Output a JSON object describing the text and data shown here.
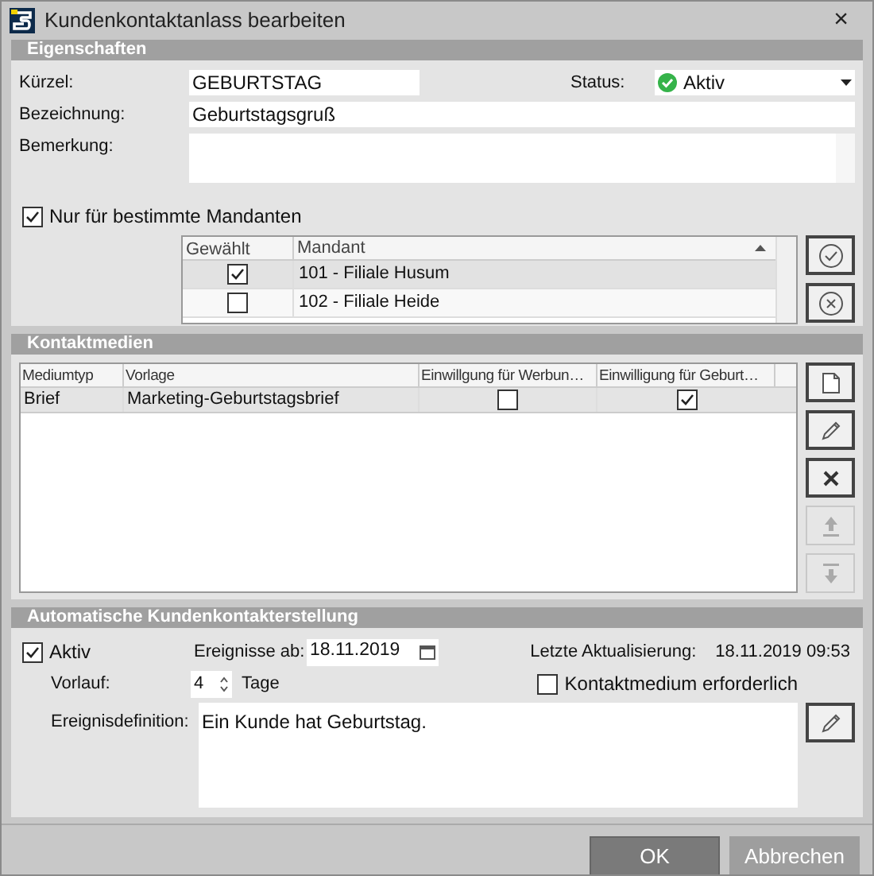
{
  "window": {
    "title": "Kundenkontaktanlass bearbeiten",
    "close": "×"
  },
  "eigenschaften": {
    "title": "Eigenschaften",
    "kuerzel": {
      "label": "Kürzel:",
      "value": "GEBURTSTAG"
    },
    "status": {
      "label": "Status:",
      "value": "Aktiv",
      "active": true
    },
    "bezeichnung": {
      "label": "Bezeichnung:",
      "value": "Geburtstagsgruß"
    },
    "bemerkung": {
      "label": "Bemerkung:"
    },
    "nur_mandanten": {
      "label": "Nur für bestimmte Mandanten",
      "checked": true
    },
    "mandanten_table": {
      "columns": [
        "Gewählt",
        "Mandant"
      ],
      "rows": [
        {
          "checked": true,
          "mandant": "101 - Filiale Husum",
          "selected": true
        },
        {
          "checked": false,
          "mandant": "102 - Filiale Heide",
          "selected": false
        }
      ]
    },
    "buttons": [
      {
        "kind": "check",
        "disabled": false
      },
      {
        "kind": "cancel",
        "disabled": false
      }
    ]
  },
  "kontaktmedien": {
    "title": "Kontaktmedien",
    "columns": [
      "Mediumtyp",
      "Vorlage",
      "Einwillgung für Werbun…",
      "Einwilligung für Geburt…"
    ],
    "rows": [
      {
        "mediumtyp": "Brief",
        "vorlage": "Marketing-Geburtstagsbrief",
        "werbung": false,
        "geburtstag": true,
        "selected": true
      }
    ],
    "buttons": [
      {
        "kind": "new",
        "disabled": false
      },
      {
        "kind": "edit",
        "disabled": false
      },
      {
        "kind": "delete",
        "disabled": false
      },
      {
        "kind": "up",
        "disabled": true
      },
      {
        "kind": "down",
        "disabled": true
      }
    ]
  },
  "automatik": {
    "title": "Automatische Kundenkontakterstellung",
    "aktiv": {
      "label": "Aktiv",
      "checked": true
    },
    "ereignisse_ab": {
      "label": "Ereignisse ab:",
      "value": "18.11.2019"
    },
    "letzte_aktualisierung": {
      "label": "Letzte Aktualisierung:",
      "value": "18.11.2019 09:53"
    },
    "vorlauf": {
      "label": "Vorlauf:",
      "value": "4",
      "unit": "Tage"
    },
    "kontaktmedium": {
      "label": "Kontaktmedium erforderlich",
      "checked": false
    },
    "ereignisdefinition": {
      "label": "Ereignisdefinition:",
      "value": "Ein Kunde hat Geburtstag."
    }
  },
  "footer": [
    {
      "label": "OK",
      "primary": true
    },
    {
      "label": "Abbrechen",
      "primary": false
    }
  ]
}
